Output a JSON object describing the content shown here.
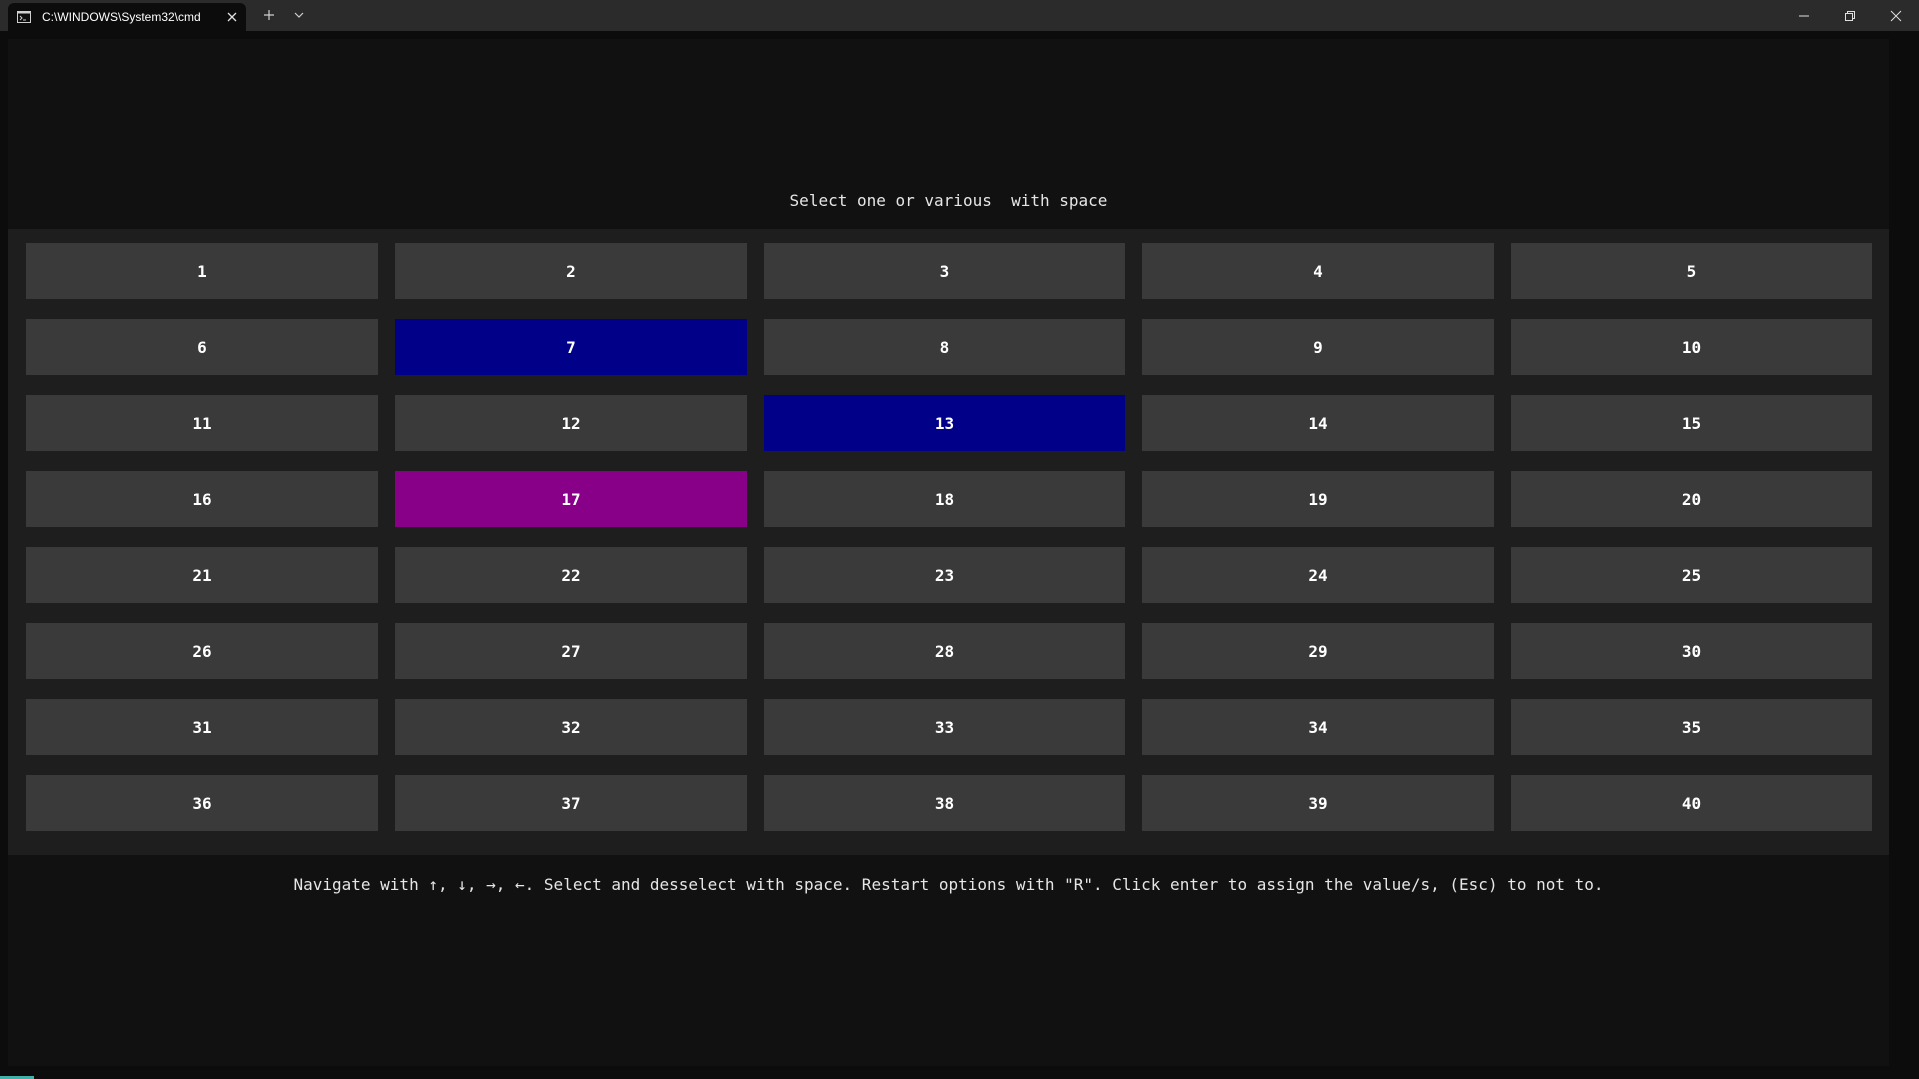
{
  "window": {
    "tab_title": "C:\\WINDOWS\\System32\\cmd"
  },
  "icons": {
    "tab": "terminal-icon",
    "tab_close": "close-icon",
    "new_tab": "plus-icon",
    "dropdown": "chevron-down-icon",
    "minimize": "minimize-icon",
    "maximize": "restore-icon",
    "close": "close-icon"
  },
  "terminal": {
    "prompt": "Select one or various  with space",
    "help": "Navigate with ↑, ↓, →, ←. Select and desselect with space. Restart options with \"R\". Click enter to assign the value/s, (Esc) to not to.",
    "options": [
      "1",
      "2",
      "3",
      "4",
      "5",
      "6",
      "7",
      "8",
      "9",
      "10",
      "11",
      "12",
      "13",
      "14",
      "15",
      "16",
      "17",
      "18",
      "19",
      "20",
      "21",
      "22",
      "23",
      "24",
      "25",
      "26",
      "27",
      "28",
      "29",
      "30",
      "31",
      "32",
      "33",
      "34",
      "35",
      "36",
      "37",
      "38",
      "39",
      "40"
    ],
    "selected": [
      "7",
      "13"
    ],
    "cursor": "17"
  },
  "colors": {
    "selected": "#000088",
    "cursor": "#880088",
    "cell": "#3a3a3a"
  }
}
